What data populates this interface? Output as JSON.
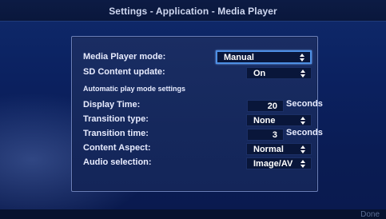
{
  "title": "Settings - Application - Media Player",
  "settings": {
    "media_player_mode": {
      "label": "Media Player mode:",
      "value": "Manual"
    },
    "sd_content_update": {
      "label": "SD Content update:",
      "value": "On"
    },
    "section_title": "Automatic play mode settings",
    "display_time": {
      "label": "Display Time:",
      "value": "20",
      "unit": "Seconds"
    },
    "transition_type": {
      "label": "Transition type:",
      "value": "None"
    },
    "transition_time": {
      "label": "Transition time:",
      "value": "3",
      "unit": "Seconds"
    },
    "content_aspect": {
      "label": "Content Aspect:",
      "value": "Normal"
    },
    "audio_selection": {
      "label": "Audio selection:",
      "value": "Image/AV"
    }
  },
  "footer": {
    "done_label": "Done"
  },
  "icons": {
    "select_arrows": "up-down-arrows-icon"
  },
  "colors": {
    "background": "#0b1e52",
    "panel": "#172a5f",
    "focus_border": "#4d8fe4",
    "text": "#e8ecff"
  }
}
